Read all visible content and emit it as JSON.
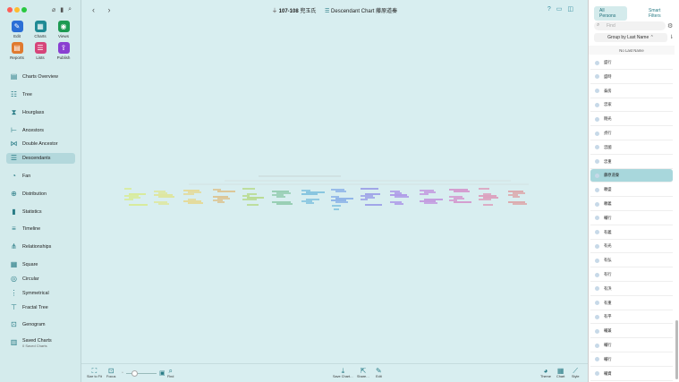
{
  "window": {
    "title_number": "107-108",
    "title_name": "兜玉氏",
    "chart_title": "Descendant Chart 藤原道秦"
  },
  "toolbar": [
    {
      "label": "Edit",
      "color": "#2b6fd6",
      "glyph": "✎"
    },
    {
      "label": "Charts",
      "color": "#1f8a94",
      "glyph": "▦"
    },
    {
      "label": "Views",
      "color": "#1c9a52",
      "glyph": "◉"
    },
    {
      "label": "Reports",
      "color": "#e07a2f",
      "glyph": "▤"
    },
    {
      "label": "Lists",
      "color": "#d6457a",
      "glyph": "☰"
    },
    {
      "label": "Publish",
      "color": "#8a3fd1",
      "glyph": "⇪"
    }
  ],
  "nav": [
    {
      "label": "Charts Overview",
      "icon": "charts-overview-icon",
      "glyph": "▤"
    },
    {
      "label": "Tree",
      "icon": "tree-icon",
      "glyph": "☷"
    },
    {
      "label": "Hourglass",
      "icon": "hourglass-icon",
      "glyph": "⧗"
    },
    {
      "label": "Ancestors",
      "icon": "ancestors-icon",
      "glyph": "⊢"
    },
    {
      "label": "Double Ancestor",
      "icon": "double-ancestor-icon",
      "glyph": "⋈"
    },
    {
      "label": "Descendants",
      "icon": "descendants-icon",
      "glyph": "☰"
    },
    {
      "label": "Fan",
      "icon": "fan-icon",
      "glyph": "◔"
    },
    {
      "label": "Distribution",
      "icon": "distribution-icon",
      "glyph": "⊕"
    },
    {
      "label": "Statistics",
      "icon": "statistics-icon",
      "glyph": "▮"
    },
    {
      "label": "Timeline",
      "icon": "timeline-icon",
      "glyph": "≡"
    },
    {
      "label": "Relationships",
      "icon": "relationships-icon",
      "glyph": "⋔"
    },
    {
      "label": "Square",
      "icon": "square-icon",
      "glyph": "▦"
    },
    {
      "label": "Circular",
      "icon": "circular-icon",
      "glyph": "◎"
    },
    {
      "label": "Symmetrical",
      "icon": "symmetrical-icon",
      "glyph": "⋮"
    },
    {
      "label": "Fractal Tree",
      "icon": "fractal-tree-icon",
      "glyph": "⊤"
    },
    {
      "label": "Genogram",
      "icon": "genogram-icon",
      "glyph": "⊡"
    },
    {
      "label": "Saved Charts",
      "icon": "saved-charts-icon",
      "glyph": "▥"
    }
  ],
  "saved_sub": "0 Saved Charts",
  "bottom": {
    "size_to_fit": "Size to Fit",
    "focus": "Focus",
    "find": "Find",
    "save_chart": "Save Chart…",
    "share": "Share…",
    "edit": "Edit",
    "theme": "Theme",
    "chart": "Chart",
    "style": "Style"
  },
  "right_panel": {
    "tabs": [
      "All Persons",
      "Smart Filters"
    ],
    "find_placeholder": "Find",
    "group_by": "Group by Last Name",
    "group_header": "No Last Name",
    "persons": [
      "盛行",
      "盛時",
      "泰房",
      "忠家",
      "剛光",
      "貞行",
      "忠國",
      "忠重",
      "藤原道秦",
      "頼盛",
      "頼義",
      "輔行",
      "有義",
      "有光",
      "有弘",
      "有行",
      "有浜",
      "有重",
      "有平",
      "輔兼",
      "輔行",
      "輔行",
      "輔資"
    ],
    "selected_index": 8
  }
}
